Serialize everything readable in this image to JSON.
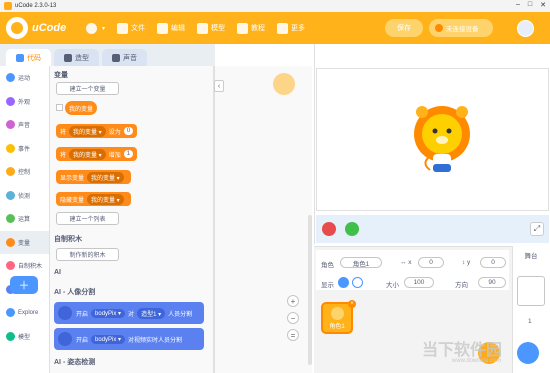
{
  "window": {
    "title": "uCode 2.3.0-13",
    "minimize": "–",
    "maximize": "□",
    "close": "✕"
  },
  "menubar": {
    "brand": "uCode",
    "language_caret": "▾",
    "items": [
      {
        "label": "文件",
        "icon": "file-icon"
      },
      {
        "label": "编辑",
        "icon": "edit-icon"
      },
      {
        "label": "模型",
        "icon": "model-icon"
      },
      {
        "label": "教程",
        "icon": "tutorial-icon"
      },
      {
        "label": "更多",
        "icon": "more-icon"
      }
    ],
    "save_label": "保存",
    "device_label": "未连接设备",
    "accent_color": "#ffb21a"
  },
  "tabs": [
    {
      "label": "代码",
      "active": true
    },
    {
      "label": "造型",
      "active": false
    },
    {
      "label": "声音",
      "active": false
    }
  ],
  "categories": [
    {
      "label": "运动",
      "color": "#4c97ff"
    },
    {
      "label": "外观",
      "color": "#9966ff"
    },
    {
      "label": "声音",
      "color": "#cf63cf"
    },
    {
      "label": "事件",
      "color": "#ffbf00"
    },
    {
      "label": "控制",
      "color": "#ffab19"
    },
    {
      "label": "侦测",
      "color": "#5cb1d6"
    },
    {
      "label": "运算",
      "color": "#59c059"
    },
    {
      "label": "变量",
      "color": "#ff8c1a",
      "active": true
    },
    {
      "label": "自制积木",
      "color": "#ff6680"
    },
    {
      "label": "AI",
      "color": "#5b80f0"
    },
    {
      "label": "Explore",
      "color": "#4c97ff"
    },
    {
      "label": "模型",
      "color": "#0fbd8c"
    }
  ],
  "palette": {
    "variables_title": "变量",
    "make_variable": "建立一个变量",
    "my_variable": "我的变量",
    "set_block": {
      "prefix": "将",
      "var": "我的变量 ▾",
      "mid": "设为",
      "value": "0"
    },
    "change_block": {
      "prefix": "将",
      "var": "我的变量 ▾",
      "mid": "增加",
      "value": "1"
    },
    "show_block": {
      "prefix": "显示变量",
      "var": "我的变量 ▾"
    },
    "hide_block": {
      "prefix": "隐藏变量",
      "var": "我的变量 ▾"
    },
    "make_list": "建立一个列表",
    "custom_title": "自制积木",
    "make_block": "制作新的积木",
    "ai_title": "AI",
    "ai_body_title": "AI - 人像分割",
    "ai_block1": {
      "prefix": "开启",
      "model": "bodyPix ▾",
      "mid": "对",
      "target": "造型1 ▾",
      "suffix": "人员分割"
    },
    "ai_block2": {
      "prefix": "开启",
      "model": "bodyPix ▾",
      "suffix": "对视频实时人员分割"
    },
    "ai_pose_title": "AI - 姿态检测"
  },
  "zoom": {
    "in": "+",
    "out": "−",
    "reset": "="
  },
  "sprite": {
    "label_sprite": "角色",
    "name": "角色1",
    "label_x": "↔ x",
    "x": "0",
    "label_y": "↕ y",
    "y": "0",
    "label_show": "显示",
    "label_size": "大小",
    "size": "100",
    "label_direction": "方向",
    "direction": "90",
    "thumb_name": "角色1"
  },
  "backdrop": {
    "title": "舞台",
    "count": "1"
  },
  "watermark": {
    "text": "当下软件园",
    "url": "www.downxia.com"
  }
}
